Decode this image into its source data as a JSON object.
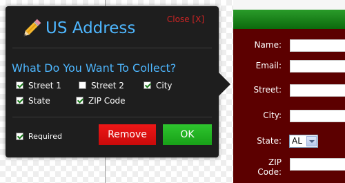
{
  "popup": {
    "title": "US Address",
    "close_label": "Close [X]",
    "section_heading": "What Do You Want To Collect?",
    "options": [
      {
        "label": "Street 1",
        "checked": true
      },
      {
        "label": "Street 2",
        "checked": false
      },
      {
        "label": "City",
        "checked": true
      },
      {
        "label": "State",
        "checked": true
      },
      {
        "label": "ZIP Code",
        "checked": true
      }
    ],
    "required": {
      "label": "Required",
      "checked": true
    },
    "remove_label": "Remove",
    "ok_label": "OK"
  },
  "form": {
    "labels": {
      "name": "Name:",
      "email": "Email:",
      "street": "Street:",
      "city": "City:",
      "state": "State:",
      "zip_line1": "ZIP",
      "zip_line2": "Code:"
    },
    "state_value": "AL"
  },
  "colors": {
    "popup_bg": "#1e1e1e",
    "title_blue": "#4eb7ff",
    "close_red": "#d02424",
    "remove_red": "#e01010",
    "ok_green": "#22b022",
    "form_bg": "#5c0000",
    "form_header_green": "#1a8a1a"
  }
}
